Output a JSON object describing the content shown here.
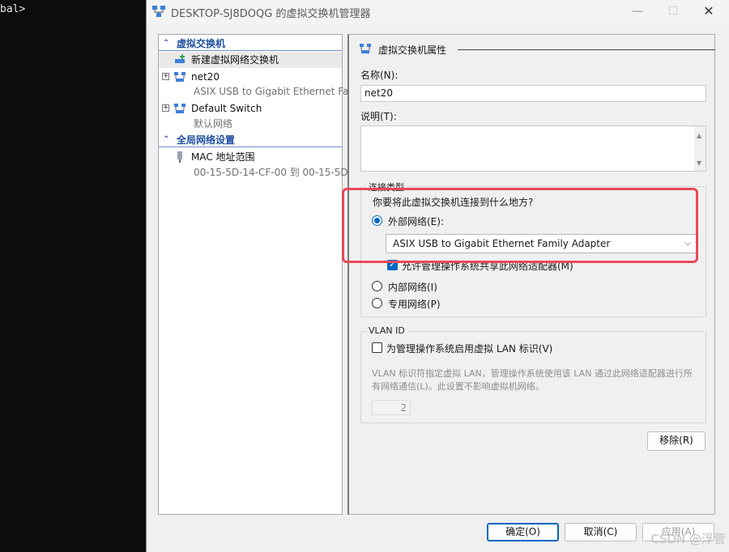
{
  "terminal": {
    "text": "bal>"
  },
  "window": {
    "title": "DESKTOP-SJ8DOQG 的虚拟交换机管理器",
    "min": "—",
    "max": "☐",
    "close": "✕"
  },
  "left": {
    "section1": "虚拟交换机",
    "new_switch": "新建虚拟网络交换机",
    "net20": {
      "name": "net20",
      "sub": "ASIX USB to Gigabit Ethernet Fa..."
    },
    "default_switch": {
      "name": "Default Switch",
      "sub": "默认网络"
    },
    "section2": "全局网络设置",
    "mac": {
      "name": "MAC 地址范围",
      "sub": "00-15-5D-14-CF-00 到 00-15-5D-..."
    }
  },
  "right": {
    "header": "虚拟交换机属性",
    "name_label": "名称(N):",
    "name_value": "net20",
    "desc_label": "说明(T):",
    "desc_value": "",
    "conn_group": "连接类型",
    "conn_question": "你要将此虚拟交换机连接到什么地方?",
    "external": "外部网络(E):",
    "adapter": "ASIX USB to Gigabit Ethernet Family Adapter",
    "allow_mgmt": "允许管理操作系统共享此网络适配器(M)",
    "internal": "内部网络(I)",
    "private": "专用网络(P)",
    "vlan_group": "VLAN ID",
    "vlan_enable": "为管理操作系统启用虚拟 LAN 标识(V)",
    "vlan_desc": "VLAN 标识符指定虚拟 LAN，管理操作系统使用该 LAN 通过此网络适配器进行所有网络通信(L)。此设置不影响虚拟机网络。",
    "vlan_value": "2",
    "remove": "移除(R)"
  },
  "footer": {
    "ok": "确定(O)",
    "cancel": "取消(C)",
    "apply": "应用(A)"
  },
  "watermark": "CSDN @浮菅",
  "colors": {
    "accent": "#0067c0",
    "highlight": "#e8495a",
    "section": "#1f4fa0"
  }
}
